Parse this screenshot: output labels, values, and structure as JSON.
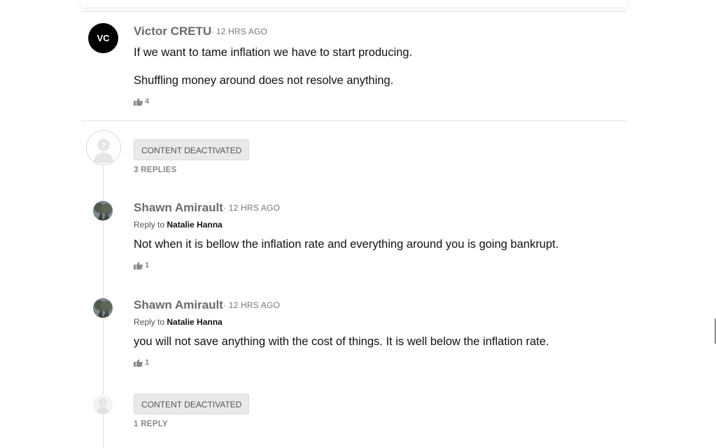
{
  "comments": [
    {
      "avatar_initials": "VC",
      "author": "Victor CRETU",
      "time": "· 12 HRS AGO",
      "paragraphs": [
        "If we want to tame inflation we have to start producing.",
        "Shuffling money around does not resolve anything."
      ],
      "likes": "4"
    },
    {
      "deactivated_label": "CONTENT DEACTIVATED",
      "replies_label": "3 REPLIES",
      "replies": [
        {
          "author": "Shawn Amirault",
          "time": "· 12 HRS AGO",
          "reply_to_prefix": "Reply to",
          "reply_to_name": "Natalie Hanna",
          "text": "Not when it is bellow the inflation rate and everything around you is going bankrupt.",
          "likes": "1"
        },
        {
          "author": "Shawn Amirault",
          "time": "· 12 HRS AGO",
          "reply_to_prefix": "Reply to",
          "reply_to_name": "Natalie Hanna",
          "text": "you will not save anything with the cost of things. It is well below the inflation rate.",
          "likes": "1"
        },
        {
          "deactivated_label": "CONTENT DEACTIVATED",
          "replies_label": "1 REPLY"
        }
      ]
    }
  ]
}
